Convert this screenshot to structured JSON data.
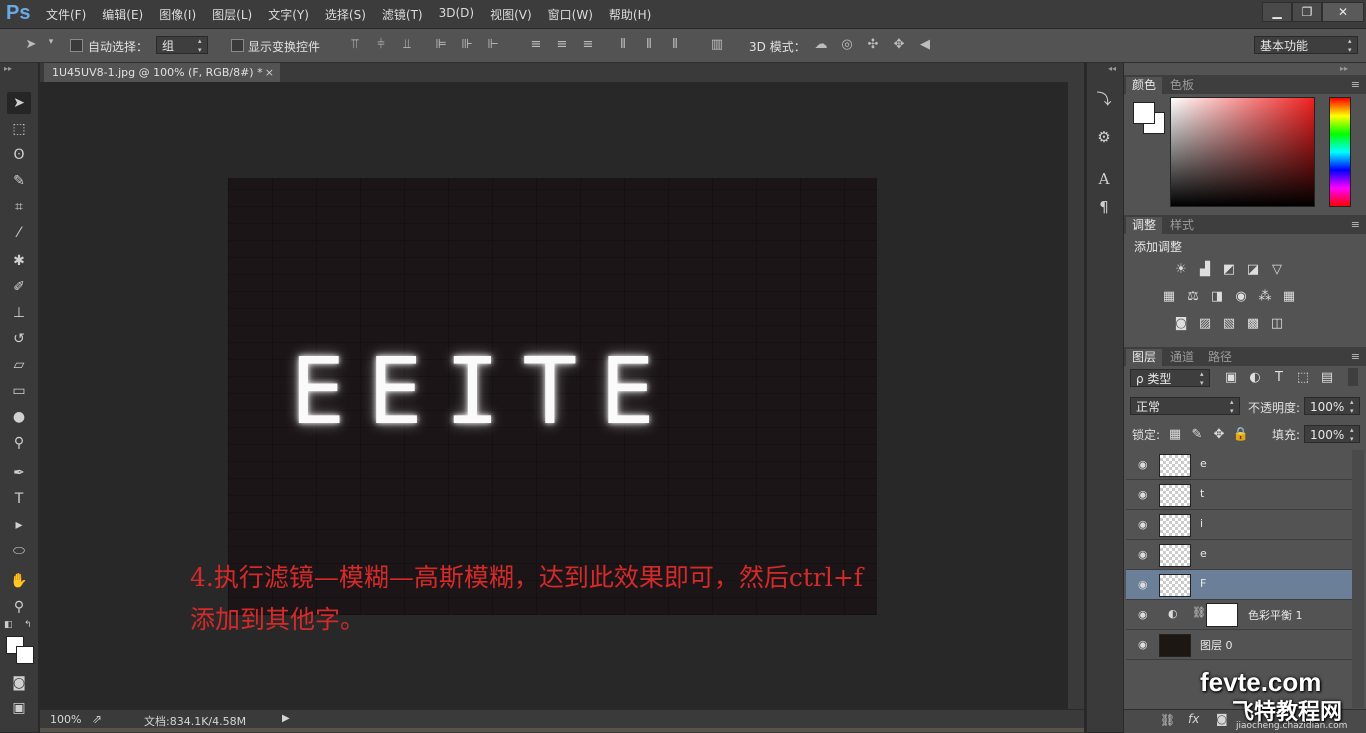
{
  "app": {
    "logo": "Ps"
  },
  "menubar": {
    "items": [
      "文件(F)",
      "编辑(E)",
      "图像(I)",
      "图层(L)",
      "文字(Y)",
      "选择(S)",
      "滤镜(T)",
      "3D(D)",
      "视图(V)",
      "窗口(W)",
      "帮助(H)"
    ]
  },
  "window_controls": {
    "minimize": "▁",
    "restore": "❐",
    "close": "✕"
  },
  "options": {
    "auto_select_label": "自动选择：",
    "auto_select_value": "组",
    "show_transform_label": "显示变换控件",
    "mode_3d_label": "3D 模式：",
    "workspace": "基本功能"
  },
  "document": {
    "tab_title": "1U45UV8-1.jpg @ 100% (F, RGB/8#) *",
    "tab_close": "×"
  },
  "canvas": {
    "neon_text": "EEITE",
    "annotation_line1": "4.执行滤镜—模糊—高斯模糊，达到此效果即可，然后ctrl+f",
    "annotation_line2": "添加到其他字。"
  },
  "status": {
    "zoom": "100%",
    "doc_info": "文档:834.1K/4.58M"
  },
  "color_panel": {
    "tabs": [
      "颜色",
      "色板"
    ],
    "accent": "#f22020"
  },
  "adjust_panel": {
    "tabs": [
      "调整",
      "样式"
    ],
    "heading": "添加调整"
  },
  "layers_panel": {
    "tabs": [
      "图层",
      "通道",
      "路径"
    ],
    "filter_label": "ρ 类型",
    "blend_mode": "正常",
    "opacity_label": "不透明度:",
    "opacity_value": "100%",
    "lock_label": "锁定:",
    "fill_label": "填充:",
    "fill_value": "100%",
    "layers": [
      {
        "name": "e"
      },
      {
        "name": "t"
      },
      {
        "name": "i"
      },
      {
        "name": "e"
      },
      {
        "name": "F"
      },
      {
        "name": "色彩平衡 1"
      },
      {
        "name": "图层 0"
      }
    ],
    "selected_color": "#6b7f99"
  },
  "watermark": {
    "line1": "fevte.com",
    "line2": "飞特教程网",
    "line3": "jiaocheng.chazidian.com"
  }
}
